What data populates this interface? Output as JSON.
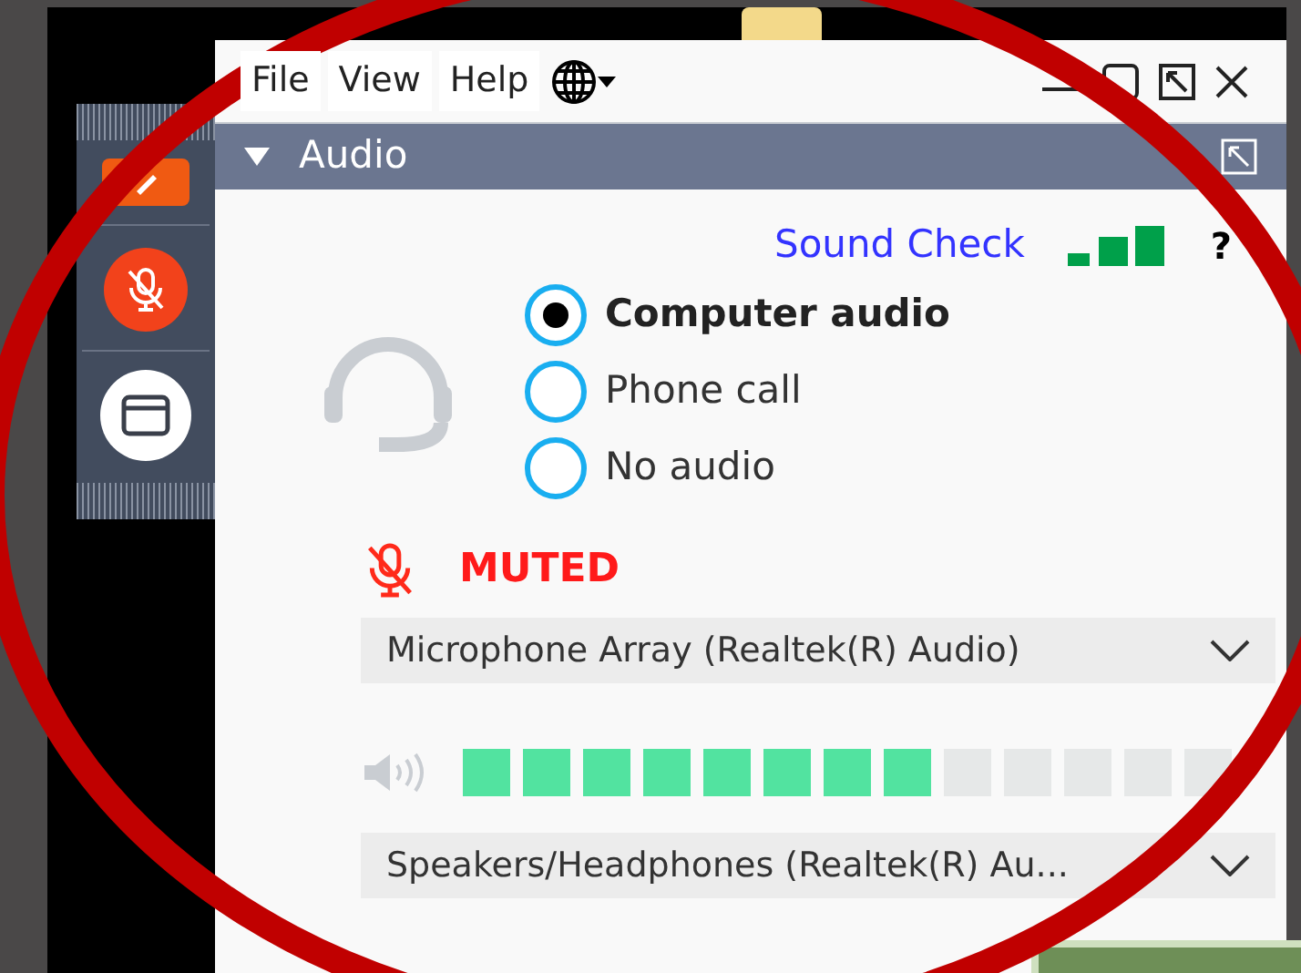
{
  "menu": [
    {
      "label": "File"
    },
    {
      "label": "View"
    },
    {
      "label": "Help"
    }
  ],
  "panel": {
    "title": "Audio",
    "expanded": true
  },
  "sound_check": {
    "label": "Sound Check",
    "help": "?"
  },
  "audio_options": [
    {
      "label": "Computer audio",
      "selected": true
    },
    {
      "label": "Phone call",
      "selected": false
    },
    {
      "label": "No audio",
      "selected": false
    }
  ],
  "microphone": {
    "muted": true,
    "status": "MUTED",
    "device": "Microphone Array (Realtek(R) Audio)"
  },
  "speaker": {
    "level": 0.62,
    "device": "Speakers/Headphones (Realtek(R) Au..."
  }
}
